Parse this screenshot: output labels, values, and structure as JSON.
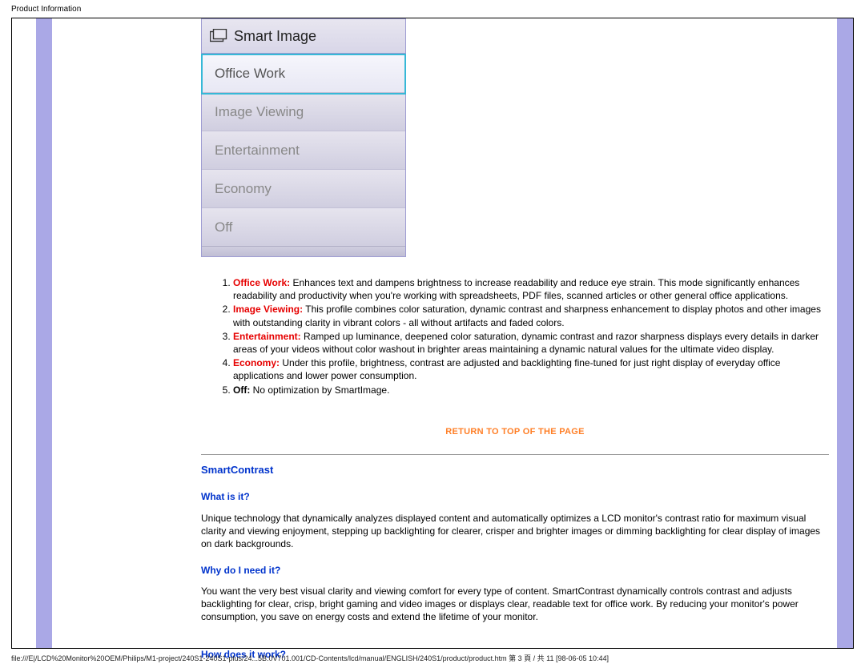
{
  "page": {
    "title": "Product Information"
  },
  "smartimage": {
    "header": "Smart Image",
    "items": [
      "Office Work",
      "Image Viewing",
      "Entertainment",
      "Economy",
      "Off"
    ],
    "selectedIndex": 0
  },
  "modes": [
    {
      "term": "Office Work:",
      "desc": "Enhances text and dampens brightness to increase readability and reduce eye strain. This mode significantly enhances readability and productivity when you're working with spreadsheets, PDF files, scanned articles or other general office applications."
    },
    {
      "term": "Image Viewing:",
      "desc": "This profile combines color saturation, dynamic contrast and sharpness enhancement to display photos and other images with outstanding clarity in vibrant colors - all without artifacts and faded colors."
    },
    {
      "term": "Entertainment:",
      "desc": "Ramped up luminance, deepened color saturation, dynamic contrast and razor sharpness displays every details in darker areas of your videos without color washout in brighter areas maintaining a dynamic natural values for the ultimate video display."
    },
    {
      "term": "Economy:",
      "desc": "Under this profile, brightness, contrast are adjusted and backlighting fine-tuned for just right display of everyday office applications and lower power consumption."
    },
    {
      "term": "Off:",
      "desc": "No optimization by SmartImage.",
      "plain": true
    }
  ],
  "links": {
    "returnTop": "RETURN TO TOP OF THE PAGE"
  },
  "smartcontrast": {
    "title": "SmartContrast",
    "q1": "What is it?",
    "p1": "Unique technology that dynamically analyzes displayed content and automatically optimizes a LCD monitor's contrast ratio for maximum visual clarity and viewing enjoyment, stepping up backlighting for clearer, crisper and brighter images or dimming backlighting for clear display of images on dark backgrounds.",
    "q2": "Why do I need it?",
    "p2": "You want the very best visual clarity and viewing comfort for every type of content. SmartContrast dynamically controls contrast and adjusts backlighting for clear, crisp, bright gaming and video images or displays clear, readable text for office work. By reducing your monitor's power consumption, you save on energy costs and extend the lifetime of your monitor.",
    "q3": "How does it work?"
  },
  "footer": {
    "path": "file:///E|/LCD%20Monitor%20OEM/Philips/M1-project/240S1-240S1-plus/24...5B.0V701.001/CD-Contents/lcd/manual/ENGLISH/240S1/product/product.htm 第 3 頁 / 共 11  [98-06-05 10:44]"
  }
}
